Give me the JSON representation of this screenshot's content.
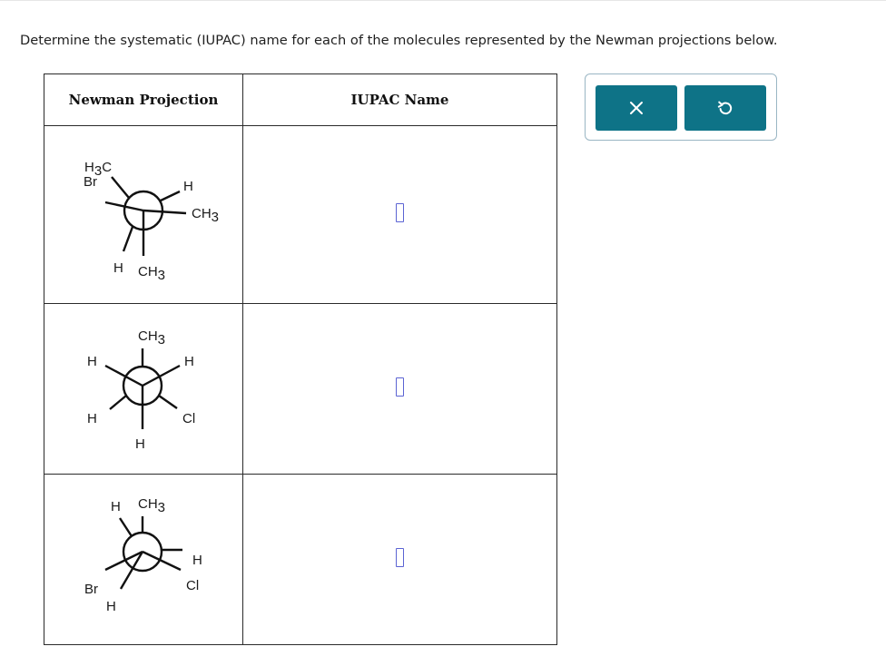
{
  "question": {
    "prompt": "Determine the systematic (IUPAC) name for each of the molecules represented by the Newman projections below."
  },
  "table": {
    "headers": [
      "Newman Projection",
      "IUPAC Name"
    ],
    "rows": [
      {
        "labels": {
          "top_left": "H3C",
          "left": "Br",
          "right_top": "H",
          "right": "CH3",
          "bottom_left": "H",
          "bottom_right": "CH3"
        },
        "answer": ""
      },
      {
        "labels": {
          "top": "CH3",
          "left_top": "H",
          "right_top": "H",
          "left_bottom": "H",
          "right_bottom": "Cl",
          "bottom": "H"
        },
        "answer": ""
      },
      {
        "labels": {
          "top_left": "H",
          "top_right": "CH3",
          "right_top": "H",
          "right_bottom": "Cl",
          "left": "Br",
          "bottom": "H"
        },
        "answer": ""
      }
    ]
  },
  "toolbar": {
    "clear_icon": "close-icon",
    "undo_icon": "undo-icon",
    "accent": "#0e7387"
  }
}
